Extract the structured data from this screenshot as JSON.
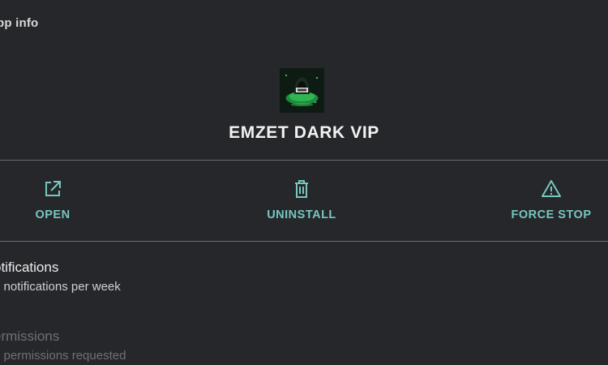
{
  "header": {
    "title": "pp info"
  },
  "app": {
    "name": "EMZET DARK VIP",
    "icon": "app-icon-green-hooded-figure"
  },
  "actions": [
    {
      "label": "OPEN",
      "icon": "open-external-icon"
    },
    {
      "label": "UNINSTALL",
      "icon": "trash-icon"
    },
    {
      "label": "FORCE STOP",
      "icon": "warning-triangle-icon"
    }
  ],
  "settings": [
    {
      "title": "otifications",
      "subtitle": "0 notifications per week",
      "enabled": true
    },
    {
      "title": "ermissions",
      "subtitle": "o permissions requested",
      "enabled": false
    }
  ],
  "colors": {
    "background": "#25272b",
    "accent": "#77c7bf",
    "divider": "#6a6c70",
    "disabled_text": "#6f7176"
  }
}
